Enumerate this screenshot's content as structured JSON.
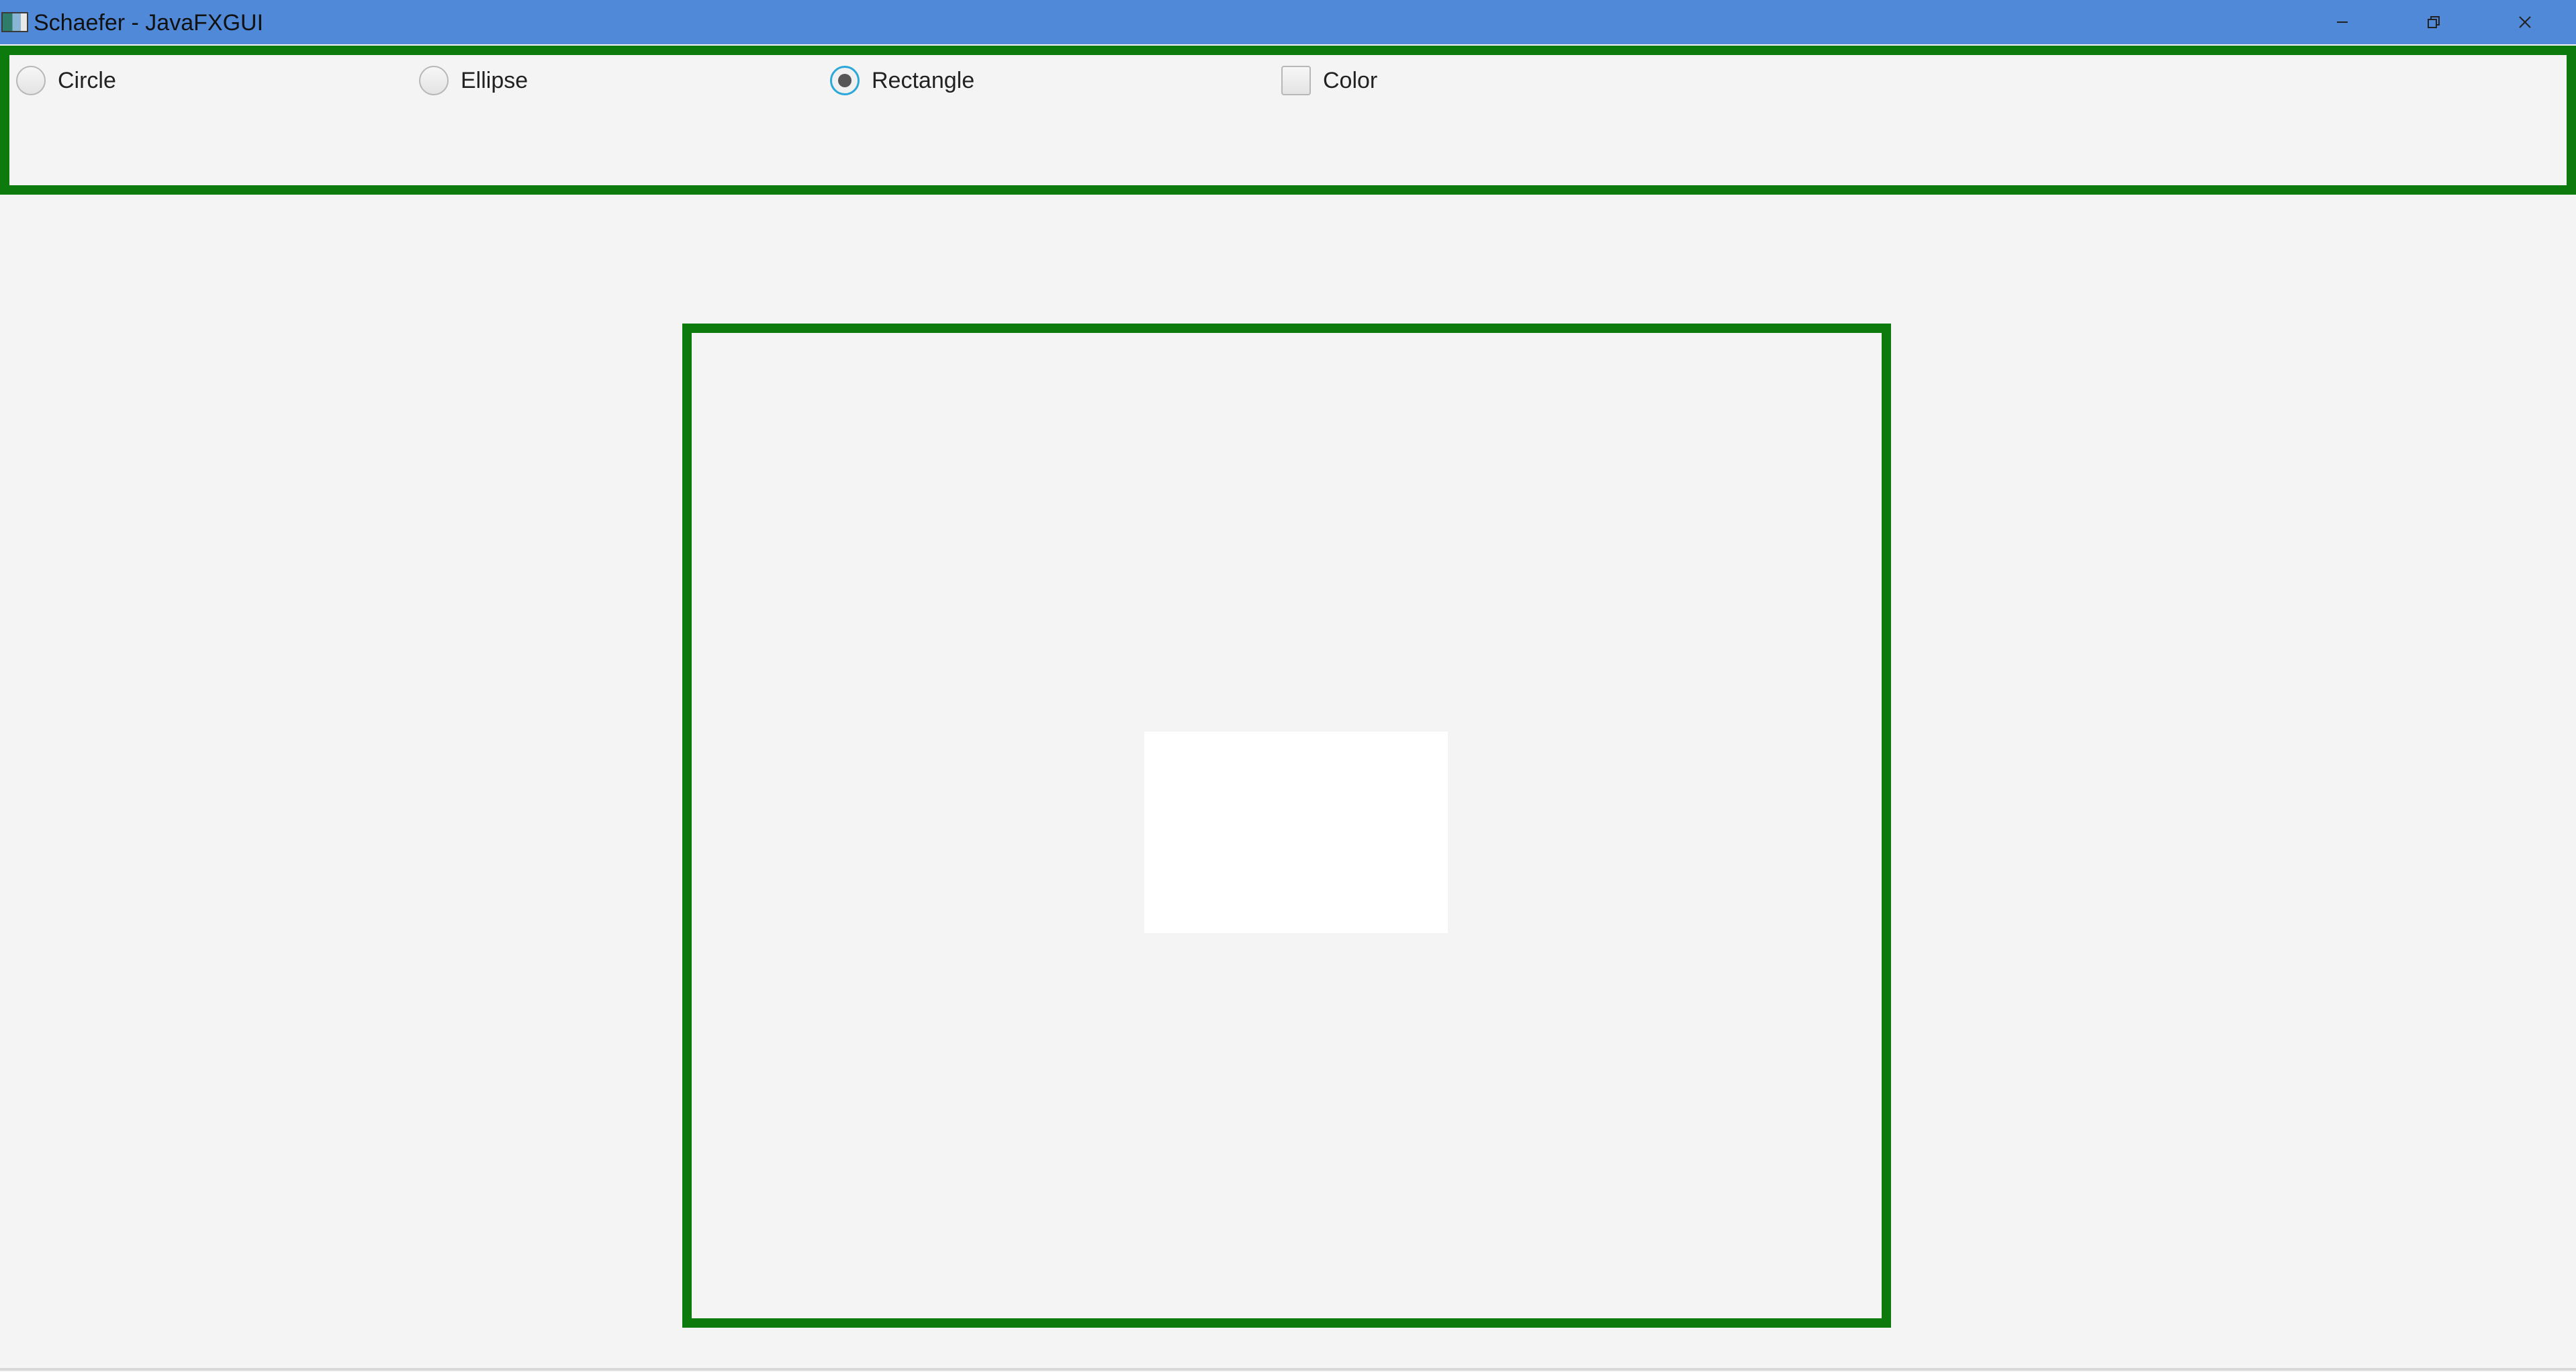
{
  "window": {
    "title": "Schaefer - JavaFXGUI",
    "titlebar_color": "#4f89d8"
  },
  "controls": {
    "minimize_icon": "minimize-icon",
    "maximize_icon": "restore-icon",
    "close_icon": "close-icon"
  },
  "options": {
    "circle": {
      "label": "Circle",
      "type": "radio",
      "selected": false
    },
    "ellipse": {
      "label": "Ellipse",
      "type": "radio",
      "selected": false
    },
    "rectangle": {
      "label": "Rectangle",
      "type": "radio",
      "selected": true
    },
    "color": {
      "label": "Color",
      "type": "checkbox",
      "checked": false
    }
  },
  "canvas": {
    "border_color": "#0c7a0c",
    "shape": {
      "kind": "rectangle",
      "fill": "#ffffff"
    }
  }
}
